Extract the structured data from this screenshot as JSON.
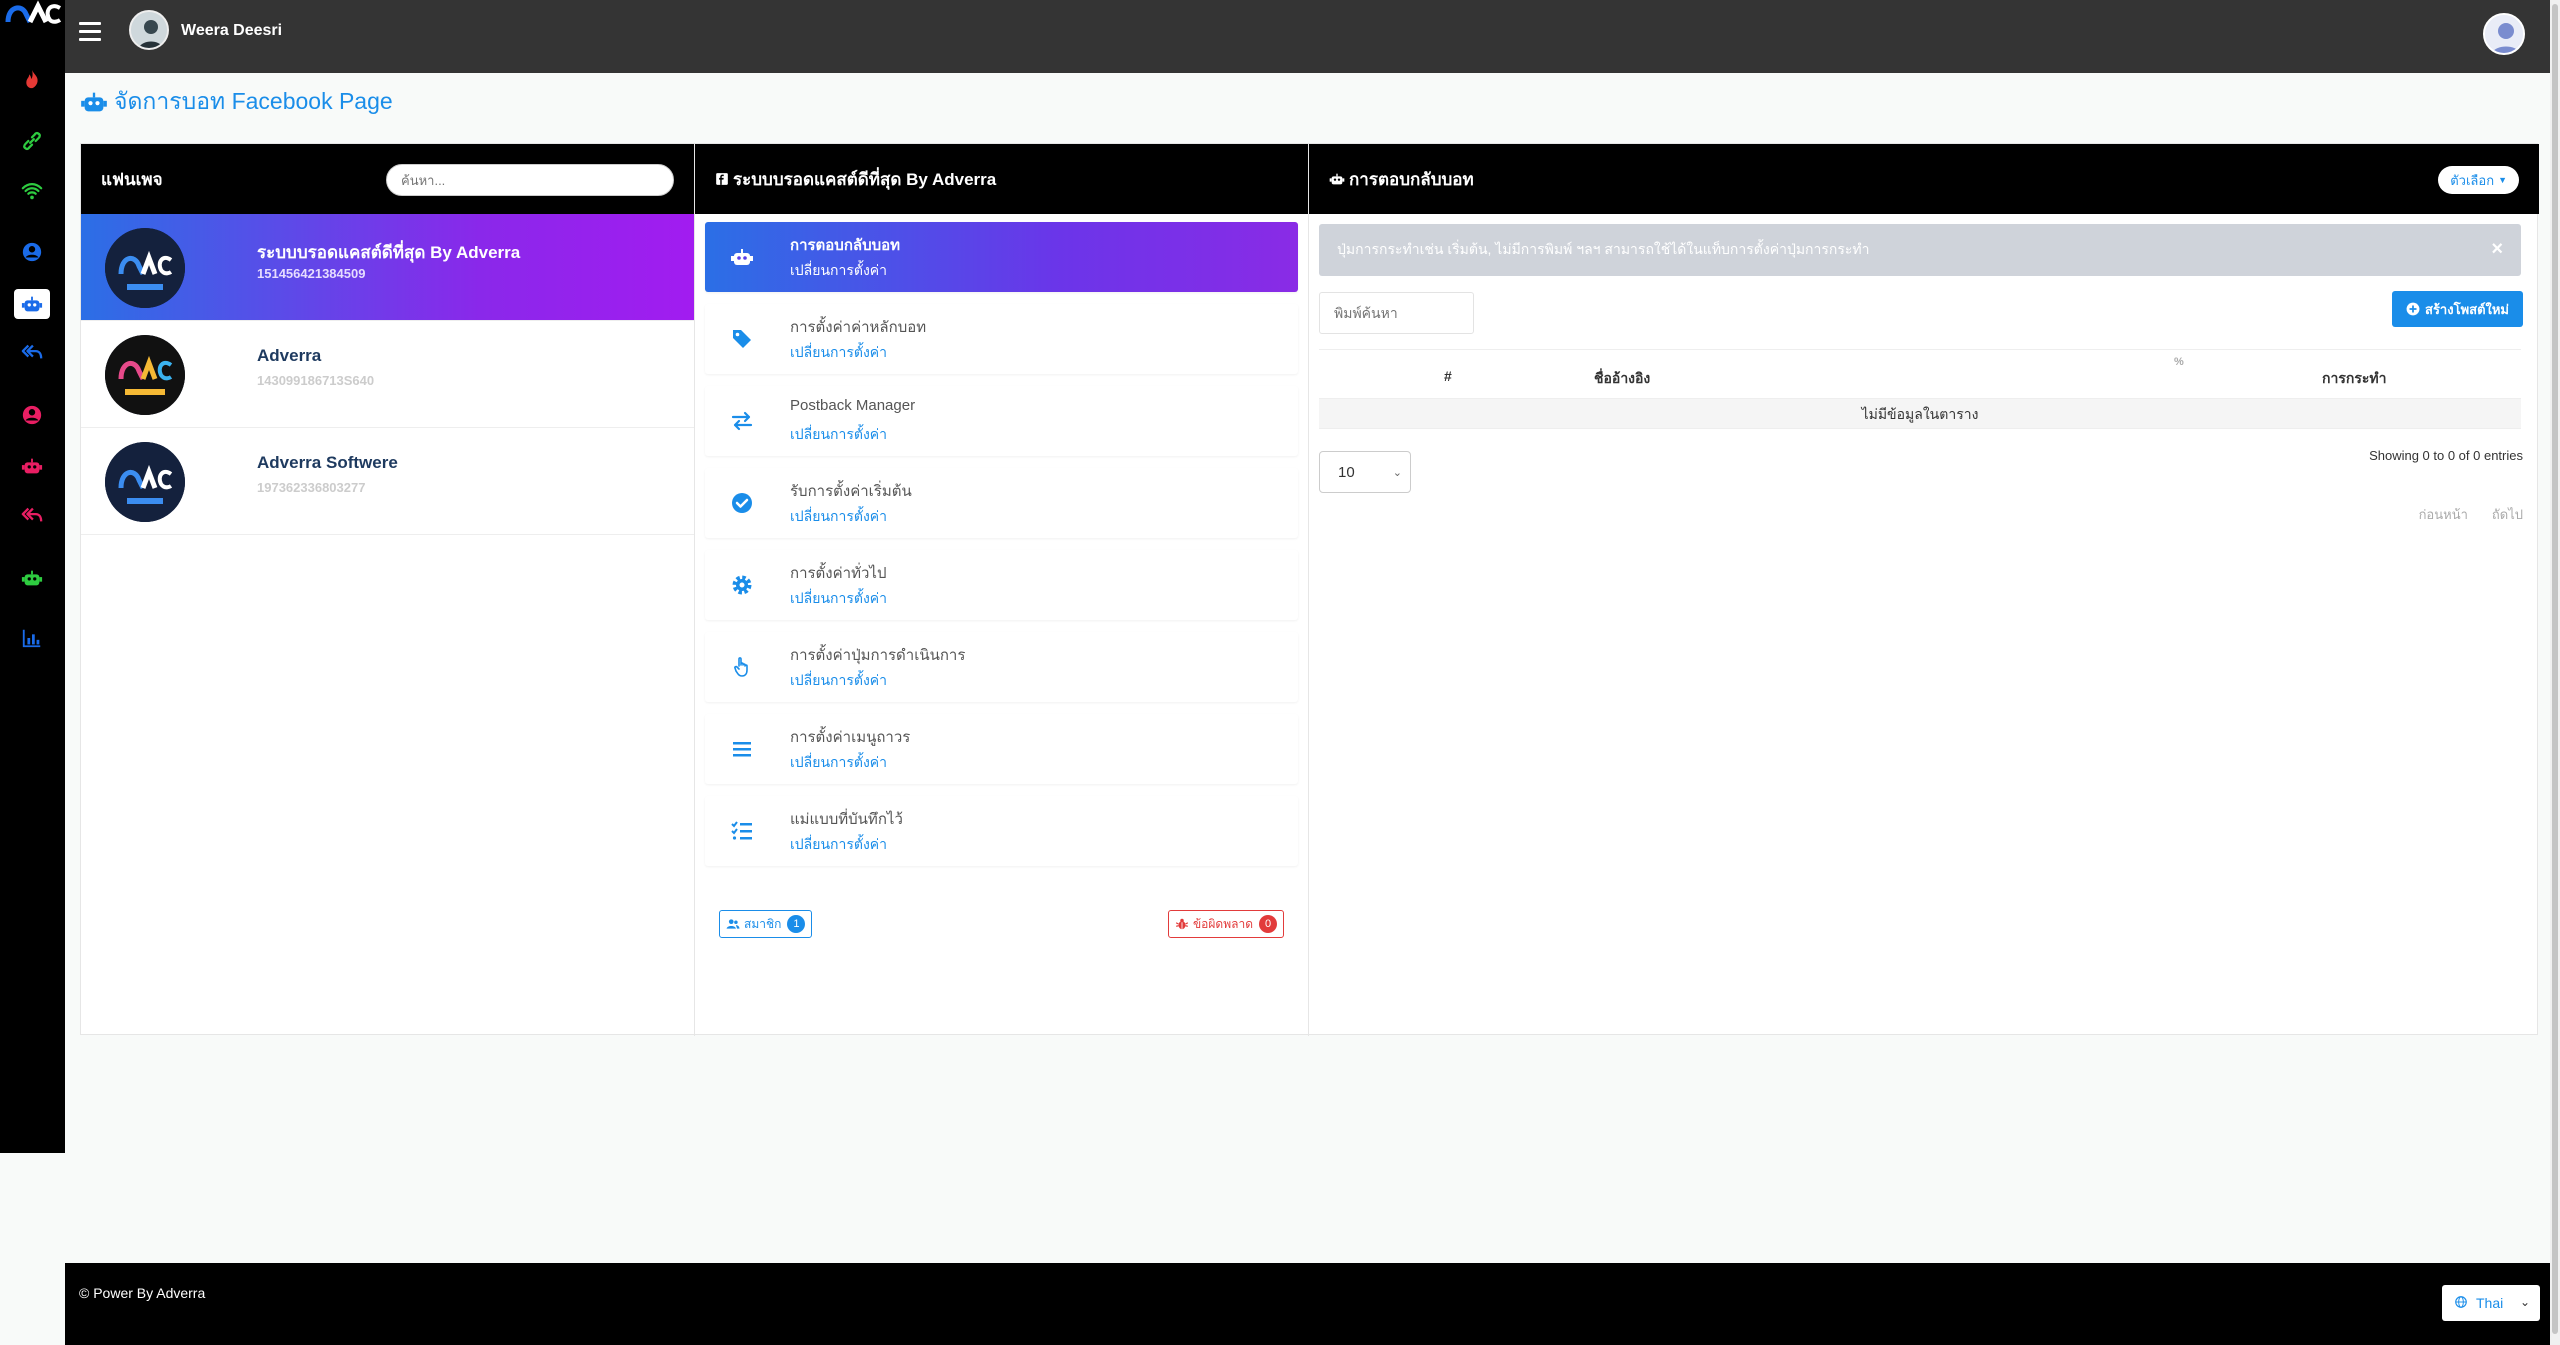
{
  "topbar": {
    "user_name": "Weera Deesri"
  },
  "page_title": "จัดการบอท Facebook Page",
  "pages_column": {
    "header": "แฟนเพจ",
    "search_placeholder": "ค้นหา...",
    "pages": [
      {
        "name": "ระบบบรอดแคสต์ดีที่สุด By Adverra",
        "id": "151456421384509",
        "active": true
      },
      {
        "name": "Adverra",
        "id": "143099186713S640",
        "active": false
      },
      {
        "name": "Adverra Softwere",
        "id": "197362336803277",
        "active": false
      }
    ]
  },
  "menu_column": {
    "header": "ระบบบรอดแคสต์ดีที่สุด By Adverra",
    "items": [
      {
        "title": "การตอบกลับบอท",
        "link": "เปลี่ยนการตั้งค่า",
        "icon": "robot-icon",
        "active": true
      },
      {
        "title": "การตั้งค่าค่าหลักบอท",
        "link": "เปลี่ยนการตั้งค่า",
        "icon": "tag-icon",
        "active": false
      },
      {
        "title": "Postback Manager",
        "link": "เปลี่ยนการตั้งค่า",
        "icon": "exchange-icon",
        "active": false
      },
      {
        "title": "รับการตั้งค่าเริ่มต้น",
        "link": "เปลี่ยนการตั้งค่า",
        "icon": "check-circle-icon",
        "active": false
      },
      {
        "title": "การตั้งค่าทั่วไป",
        "link": "เปลี่ยนการตั้งค่า",
        "icon": "gear-icon",
        "active": false
      },
      {
        "title": "การตั้งค่าปุ่มการดำเนินการ",
        "link": "เปลี่ยนการตั้งค่า",
        "icon": "hand-pointer-icon",
        "active": false
      },
      {
        "title": "การตั้งค่าเมนูถาวร",
        "link": "เปลี่ยนการตั้งค่า",
        "icon": "bars-icon",
        "active": false
      },
      {
        "title": "แม่แบบที่บันทึกไว้",
        "link": "เปลี่ยนการตั้งค่า",
        "icon": "list-check-icon",
        "active": false
      }
    ],
    "members_label": "สมาชิก",
    "members_count": "1",
    "errors_label": "ข้อผิดพลาด",
    "errors_count": "0"
  },
  "reply_column": {
    "header": "การตอบกลับบอท",
    "options_label": "ตัวเลือก",
    "alert_text": "ปุ่มการกระทำเช่น เริ่มต้น, ไม่มีการพิมพ์ ฯลฯ สามารถใช้ได้ในแท็บการตั้งค่าปุ่มการกระทำ",
    "search_placeholder": "พิมพ์ค้นหา",
    "create_label": "สร้างโพสต์ใหม่",
    "table_headers": [
      "#",
      "ชื่ออ้างอิง",
      "การกระทำ"
    ],
    "percent_mark": "%",
    "empty_text": "ไม่มีข้อมูลในตาราง",
    "page_length": "10",
    "showing_text": "Showing 0 to 0 of 0 entries",
    "prev_label": "ก่อนหน้า",
    "next_label": "ถัดไป"
  },
  "footer": {
    "text": "© Power By Adverra",
    "language": "Thai"
  }
}
